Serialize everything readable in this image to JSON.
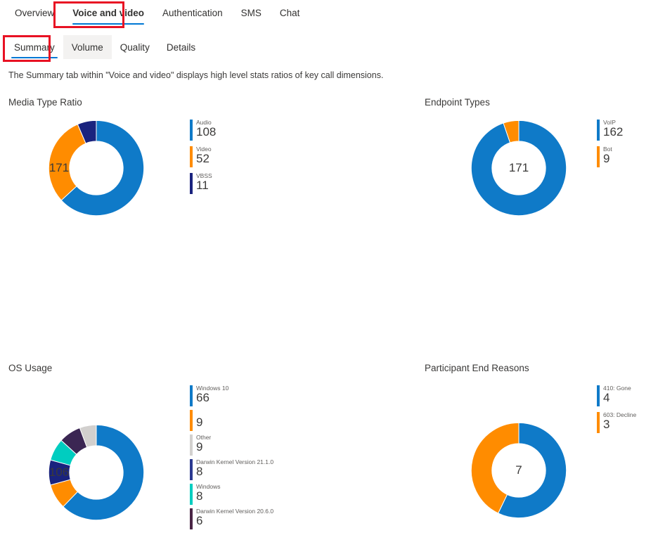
{
  "top_tabs": [
    {
      "label": "Overview",
      "active": false
    },
    {
      "label": "Voice and video",
      "active": true
    },
    {
      "label": "Authentication",
      "active": false
    },
    {
      "label": "SMS",
      "active": false
    },
    {
      "label": "Chat",
      "active": false
    }
  ],
  "sub_tabs": [
    {
      "label": "Summary",
      "active": true,
      "hovered": false
    },
    {
      "label": "Volume",
      "active": false,
      "hovered": true
    },
    {
      "label": "Quality",
      "active": false,
      "hovered": false
    },
    {
      "label": "Details",
      "active": false,
      "hovered": false
    }
  ],
  "description": "The Summary tab within \"Voice and video\" displays high level stats ratios of key call dimensions.",
  "colors": {
    "accent_blue": "#0078d4",
    "orange": "#ff8c00",
    "navy": "#1a237e",
    "teal": "#00cdc0",
    "dark_purple": "#3b2653",
    "gray": "#d2d0ce",
    "annotation_red": "#e81123"
  },
  "chart_data": [
    {
      "type": "pie",
      "title": "Media Type Ratio",
      "center_total": "171",
      "total": 171,
      "categories": [
        "Audio",
        "Video",
        "VBSS"
      ],
      "values": [
        108,
        52,
        11
      ],
      "colors": [
        "#0f7ac8",
        "#ff8c00",
        "#1a237e"
      ],
      "legend_position": "right"
    },
    {
      "type": "pie",
      "title": "Endpoint Types",
      "center_total": "171",
      "total": 171,
      "categories": [
        "VoIP",
        "Bot"
      ],
      "values": [
        162,
        9
      ],
      "colors": [
        "#0f7ac8",
        "#ff8c00"
      ],
      "legend_position": "right"
    },
    {
      "type": "pie",
      "title": "OS Usage",
      "center_total": "106",
      "total": 106,
      "categories": [
        "Windows 10",
        "",
        "Other",
        "Darwin Kernel Version 21.1.0",
        "Windows",
        "Darwin Kernel Version 20.6.0"
      ],
      "values": [
        66,
        9,
        9,
        8,
        8,
        6
      ],
      "colors": [
        "#0f7ac8",
        "#ff8c00",
        "#1a237e",
        "#00cdc0",
        "#3b2653",
        "#d2d0ce"
      ],
      "legend_colors": [
        "#0f7ac8",
        "#ff8c00",
        "#d2d0ce",
        "#2b3990",
        "#00cdc0",
        "#4a2545"
      ],
      "legend_position": "right"
    },
    {
      "type": "pie",
      "title": "Participant End Reasons",
      "center_total": "7",
      "total": 7,
      "categories": [
        "410: Gone",
        "603: Decline"
      ],
      "values": [
        4,
        3
      ],
      "colors": [
        "#0f7ac8",
        "#ff8c00"
      ],
      "legend_position": "right"
    }
  ]
}
